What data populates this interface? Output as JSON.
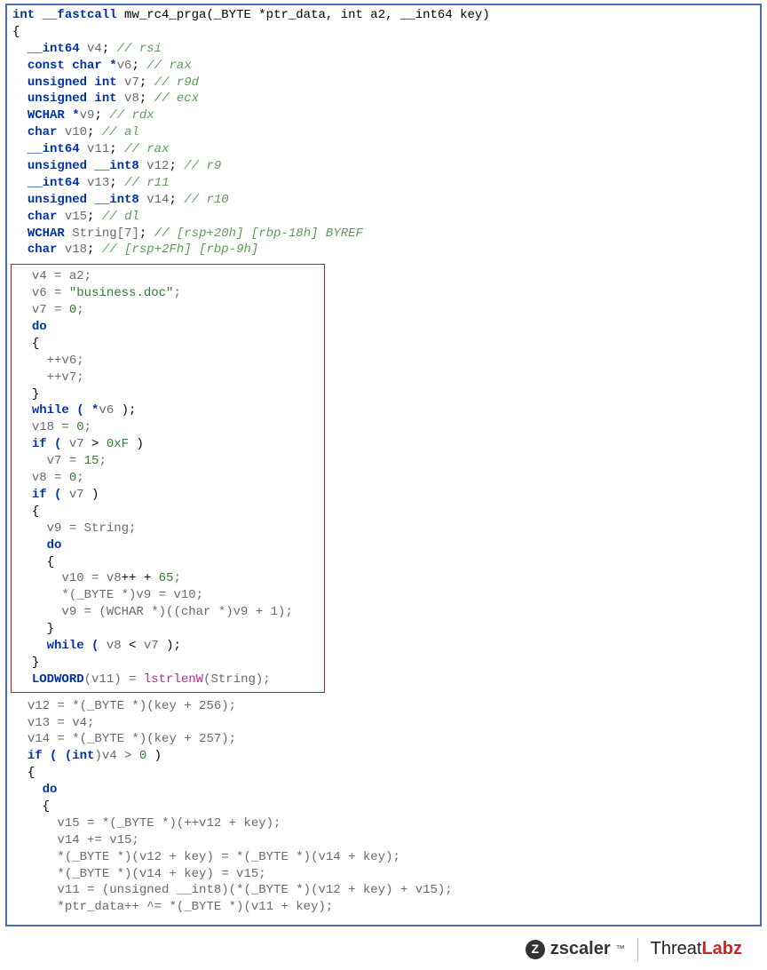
{
  "signature": {
    "ret": "int",
    "cc": "__fastcall",
    "name": "mw_rc4_prga",
    "params": "(_BYTE *ptr_data, int a2, __int64 key)"
  },
  "decls": [
    {
      "type": "__int64",
      "name": "v4",
      "cmt": "// rsi"
    },
    {
      "type": "const char *",
      "name": "v6",
      "cmt": "// rax"
    },
    {
      "type": "unsigned int",
      "name": "v7",
      "cmt": "// r9d"
    },
    {
      "type": "unsigned int",
      "name": "v8",
      "cmt": "// ecx"
    },
    {
      "type": "WCHAR *",
      "name": "v9",
      "cmt": "// rdx"
    },
    {
      "type": "char",
      "name": "v10",
      "cmt": "// al"
    },
    {
      "type": "__int64",
      "name": "v11",
      "cmt": "// rax"
    },
    {
      "type": "unsigned __int8",
      "name": "v12",
      "cmt": "// r9"
    },
    {
      "type": "__int64",
      "name": "v13",
      "cmt": "// r11"
    },
    {
      "type": "unsigned __int8",
      "name": "v14",
      "cmt": "// r10"
    },
    {
      "type": "char",
      "name": "v15",
      "cmt": "// dl"
    },
    {
      "type": "WCHAR",
      "name": "String[7]",
      "cmt": "// [rsp+20h] [rbp-18h] BYREF"
    },
    {
      "type": "char",
      "name": "v18",
      "cmt": "// [rsp+2Fh] [rbp-9h]"
    }
  ],
  "box": {
    "l1": "v4 = a2;",
    "l2a": "v6 = ",
    "l2s": "\"business.doc\"",
    "l2b": ";",
    "l3": "v7 = ",
    "l3n": "0",
    "l3b": ";",
    "l4": "do",
    "l5": "{",
    "l6": "++v6;",
    "l7": "++v7;",
    "l8": "}",
    "l9a": "while ( *",
    "l9b": "v6",
    "l9c": " );",
    "l10": "v18 = ",
    "l10n": "0",
    "l10b": ";",
    "l11a": "if ( ",
    "l11b": "v7",
    "l11c": " > ",
    "l11n": "0xF",
    "l11d": " )",
    "l12": "v7 = ",
    "l12n": "15",
    "l12b": ";",
    "l13": "v8 = ",
    "l13n": "0",
    "l13b": ";",
    "l14a": "if ( ",
    "l14b": "v7",
    "l14c": " )",
    "l15": "{",
    "l16": "v9 = String;",
    "l17": "do",
    "l18": "{",
    "l19a": "v10 = ",
    "l19b": "v8",
    "l19c": "++ + ",
    "l19n": "65",
    "l19d": ";",
    "l20": "*(_BYTE *)v9 = v10;",
    "l21": "v9 = (WCHAR *)((char *)v9 + 1);",
    "l22": "}",
    "l23a": "while ( ",
    "l23b": "v8",
    "l23c": " < ",
    "l23d": "v7",
    "l23e": " );",
    "l24": "}",
    "l25a": "LODWORD",
    "l25b": "(v11) = ",
    "l25fn": "lstrlenW",
    "l25c": "(String);"
  },
  "tail": {
    "t1": "v12 = *(_BYTE *)(key + 256);",
    "t2": "v13 = v4;",
    "t3": "v14 = *(_BYTE *)(key + 257);",
    "t4a": "if ( (",
    "t4b": "int",
    "t4c": ")v4 > ",
    "t4n": "0",
    "t4d": " )",
    "t5": "{",
    "t6": "do",
    "t7": "{",
    "t8": "v15 = *(_BYTE *)(++v12 + key);",
    "t9": "v14 += v15;",
    "t10": "*(_BYTE *)(v12 + key) = *(_BYTE *)(v14 + key);",
    "t11": "*(_BYTE *)(v14 + key) = v15;",
    "t12": "v11 = (unsigned __int8)(*(_BYTE *)(v12 + key) + v15);",
    "t13": "*ptr_data++ ^= *(_BYTE *)(v11 + key);"
  },
  "footer": {
    "brand1": "zscaler",
    "tm": "™",
    "brand2a": "Threat",
    "brand2b": "Labz"
  }
}
